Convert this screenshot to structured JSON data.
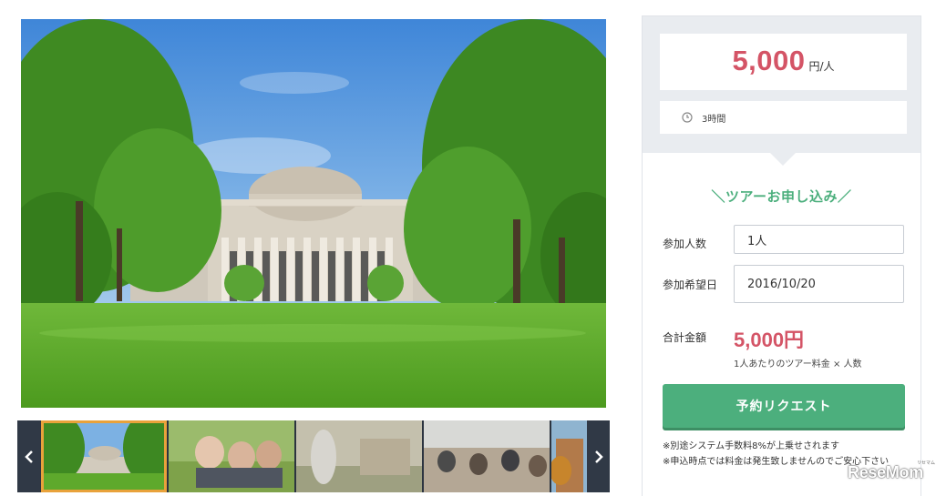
{
  "booking": {
    "price_amount": "5,000",
    "price_unit": "円/人",
    "duration": "3時間",
    "form_title": "＼ツアーお申し込み／",
    "participants_label": "参加人数",
    "participants_value": "1人",
    "date_label": "参加希望日",
    "date_value": "2016/10/20",
    "total_label": "合計金額",
    "total_amount": "5,000円",
    "total_note": "1人あたりのツアー料金 × 人数",
    "request_button": "予約リクエスト",
    "note_1": "※別途システム手数料8%が上乗せされます",
    "note_2": "※申込時点では料金は発生致しませんのでご安心下さい"
  },
  "gallery": {
    "icons": {
      "prev": "chevron-left-icon",
      "next": "chevron-right-icon",
      "clock": "clock-icon"
    }
  },
  "watermark": {
    "text": "ReseMom",
    "sub": "リセマム"
  },
  "colors": {
    "accent_price": "#d45466",
    "accent_green": "#4caf7d",
    "panel_bg": "#e9ecf0",
    "thumb_highlight": "#e9a23b"
  }
}
